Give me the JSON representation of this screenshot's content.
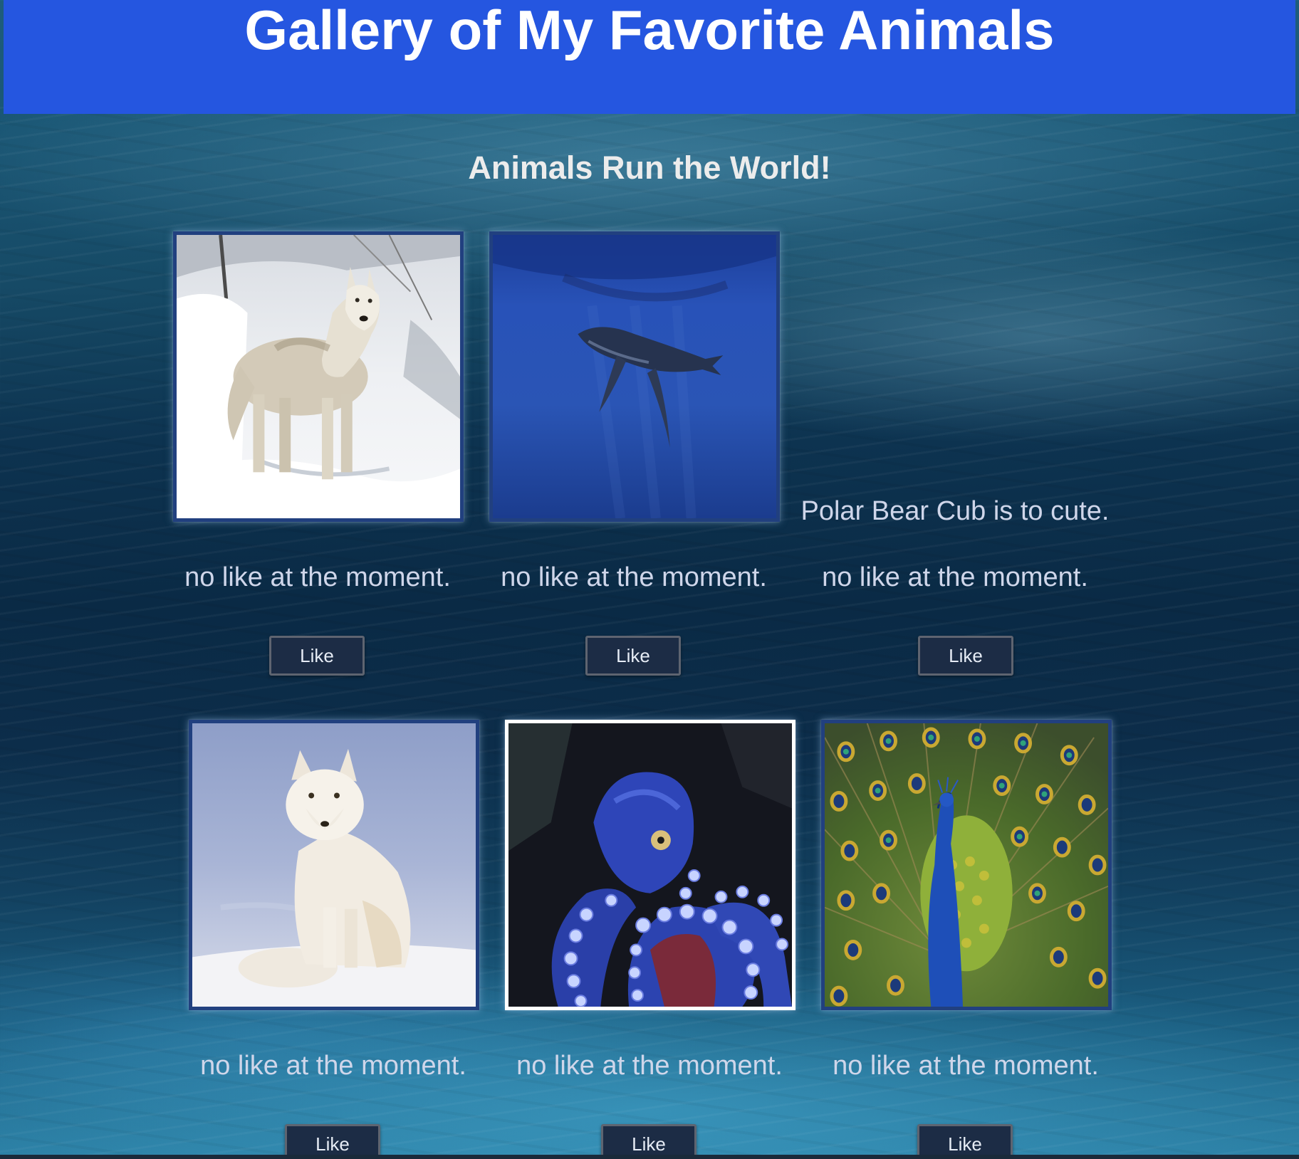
{
  "header": {
    "title": "Gallery of My Favorite Animals",
    "background_color": "#2556e0"
  },
  "subtitle": "Animals Run the World!",
  "gallery": [
    {
      "animal": "arctic wolf",
      "caption": "",
      "likes_text": "no like at the moment.",
      "button_label": "Like",
      "has_image": true
    },
    {
      "animal": "humpback whale",
      "caption": "",
      "likes_text": "no like at the moment.",
      "button_label": "Like",
      "has_image": true
    },
    {
      "animal": "polar bear cub",
      "caption": "Polar Bear Cub is to cute.",
      "likes_text": "no like at the moment.",
      "button_label": "Like",
      "has_image": false
    },
    {
      "animal": "arctic fox",
      "caption": "",
      "likes_text": "no like at the moment.",
      "button_label": "Like",
      "has_image": true
    },
    {
      "animal": "blue octopus",
      "caption": "",
      "likes_text": "no like at the moment.",
      "button_label": "Like",
      "has_image": true
    },
    {
      "animal": "peacock",
      "caption": "",
      "likes_text": "no like at the moment.",
      "button_label": "Like",
      "has_image": true
    }
  ]
}
